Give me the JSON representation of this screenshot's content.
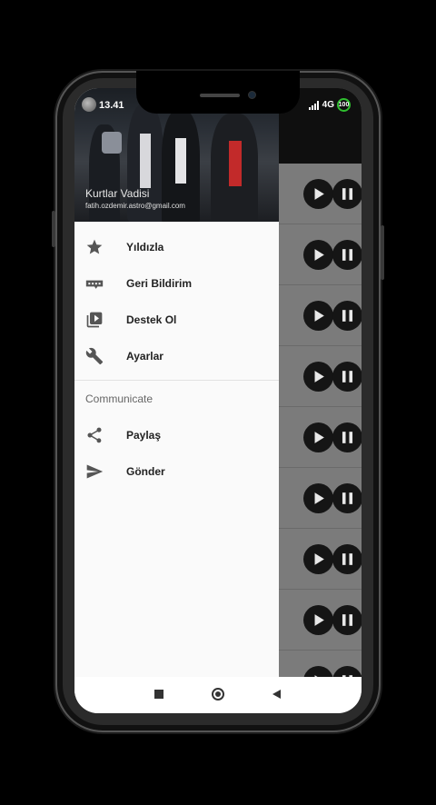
{
  "status_bar": {
    "time": "13.41",
    "network": "4G",
    "battery": "100"
  },
  "drawer": {
    "header": {
      "title": "Kurtlar Vadisi",
      "email": "fatih.ozdemir.astro@gmail.com"
    },
    "items": [
      {
        "label": "Yıldızla",
        "icon": "star-icon"
      },
      {
        "label": "Geri Bildirim",
        "icon": "feedback-icon"
      },
      {
        "label": "Destek Ol",
        "icon": "video-library-icon"
      },
      {
        "label": "Ayarlar",
        "icon": "wrench-icon"
      }
    ],
    "section_title": "Communicate",
    "section_items": [
      {
        "label": "Paylaş",
        "icon": "share-icon"
      },
      {
        "label": "Gönder",
        "icon": "send-icon"
      }
    ]
  },
  "background_list": {
    "rows": 9,
    "controls": [
      "play-icon",
      "pause-icon"
    ]
  },
  "colors": {
    "drawer_bg": "#fafafa",
    "icon": "#555555",
    "scrim": "#7a7a7a",
    "battery_ring": "#2fbf2f"
  }
}
